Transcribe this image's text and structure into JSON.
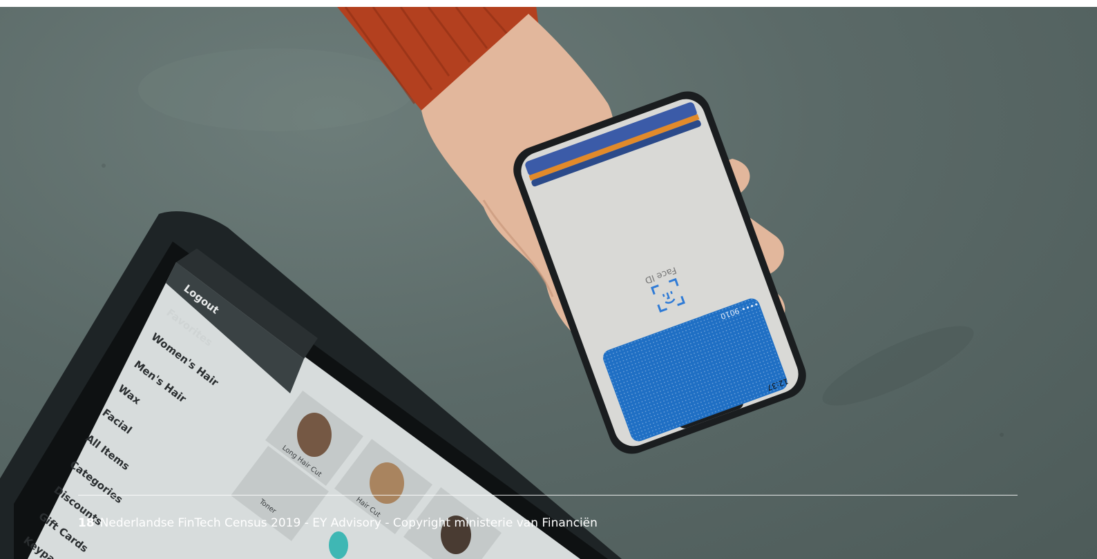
{
  "footer": {
    "page_number": "18",
    "text": "Nederlandse FinTech Census 2019 - EY Advisory - Copyright ministerie van Financiën"
  },
  "phone": {
    "face_id_label": "Face ID",
    "card_number": "•••• 9010",
    "time": "12:37",
    "face_id_icon": "face-id-icon"
  },
  "tablet": {
    "menu_items": [
      "Logout",
      "Favorites",
      "Women's Hair",
      "Men's Hair",
      "Wax",
      "Facial",
      "All Items",
      "Categories",
      "Discounts",
      "Gift Cards",
      "Keypad"
    ],
    "product_labels": [
      "Long Hair Cut",
      "Hair Cut",
      "Toner"
    ]
  },
  "colors": {
    "concrete": "#5b6a68",
    "card_blue": "#1f6fc4",
    "sleeve": "#b3401f"
  }
}
